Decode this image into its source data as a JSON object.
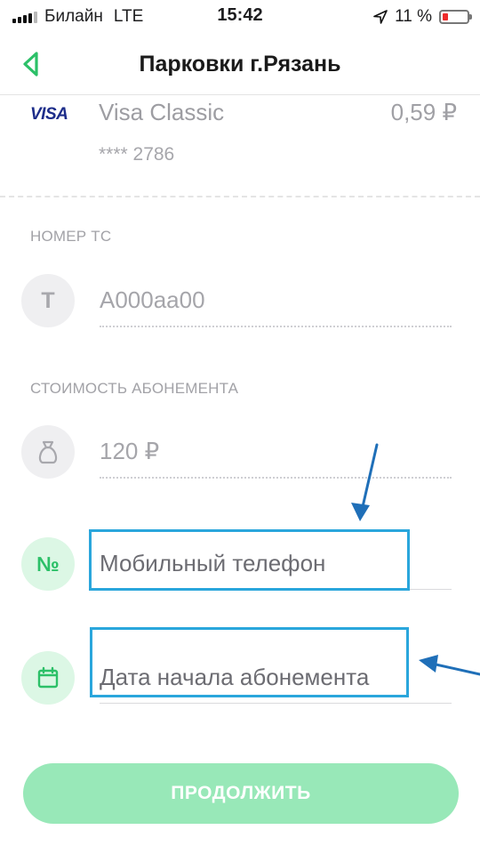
{
  "status_bar": {
    "carrier": "Билайн",
    "network": "LTE",
    "time": "15:42",
    "battery_percent": "11 %",
    "battery_level": 0.11,
    "battery_color": "#ee2b2b"
  },
  "nav": {
    "title": "Парковки г.Рязань",
    "back_icon": "chevron-left-icon"
  },
  "payment_card": {
    "brand": "VISA",
    "name": "Visa Classic",
    "amount": "0,59 ₽",
    "number_masked": "**** 2786"
  },
  "vehicle": {
    "section_label": "НОМЕР ТС",
    "icon_letter": "Т",
    "placeholder": "А000аа00"
  },
  "subscription": {
    "section_label": "СТОИМОСТЬ АБОНЕМЕНТА",
    "icon": "money-bag-icon",
    "value": "120 ₽"
  },
  "phone": {
    "icon_glyph": "№",
    "placeholder": "Мобильный телефон"
  },
  "start_date": {
    "icon": "calendar-icon",
    "placeholder": "Дата начала абонемента"
  },
  "actions": {
    "continue_label": "ПРОДОЛЖИТЬ"
  },
  "colors": {
    "accent_green": "#2cc068",
    "button_green": "#98e8b8",
    "annotation_blue": "#2aa6dc",
    "arrow_blue": "#1f6fb8"
  }
}
